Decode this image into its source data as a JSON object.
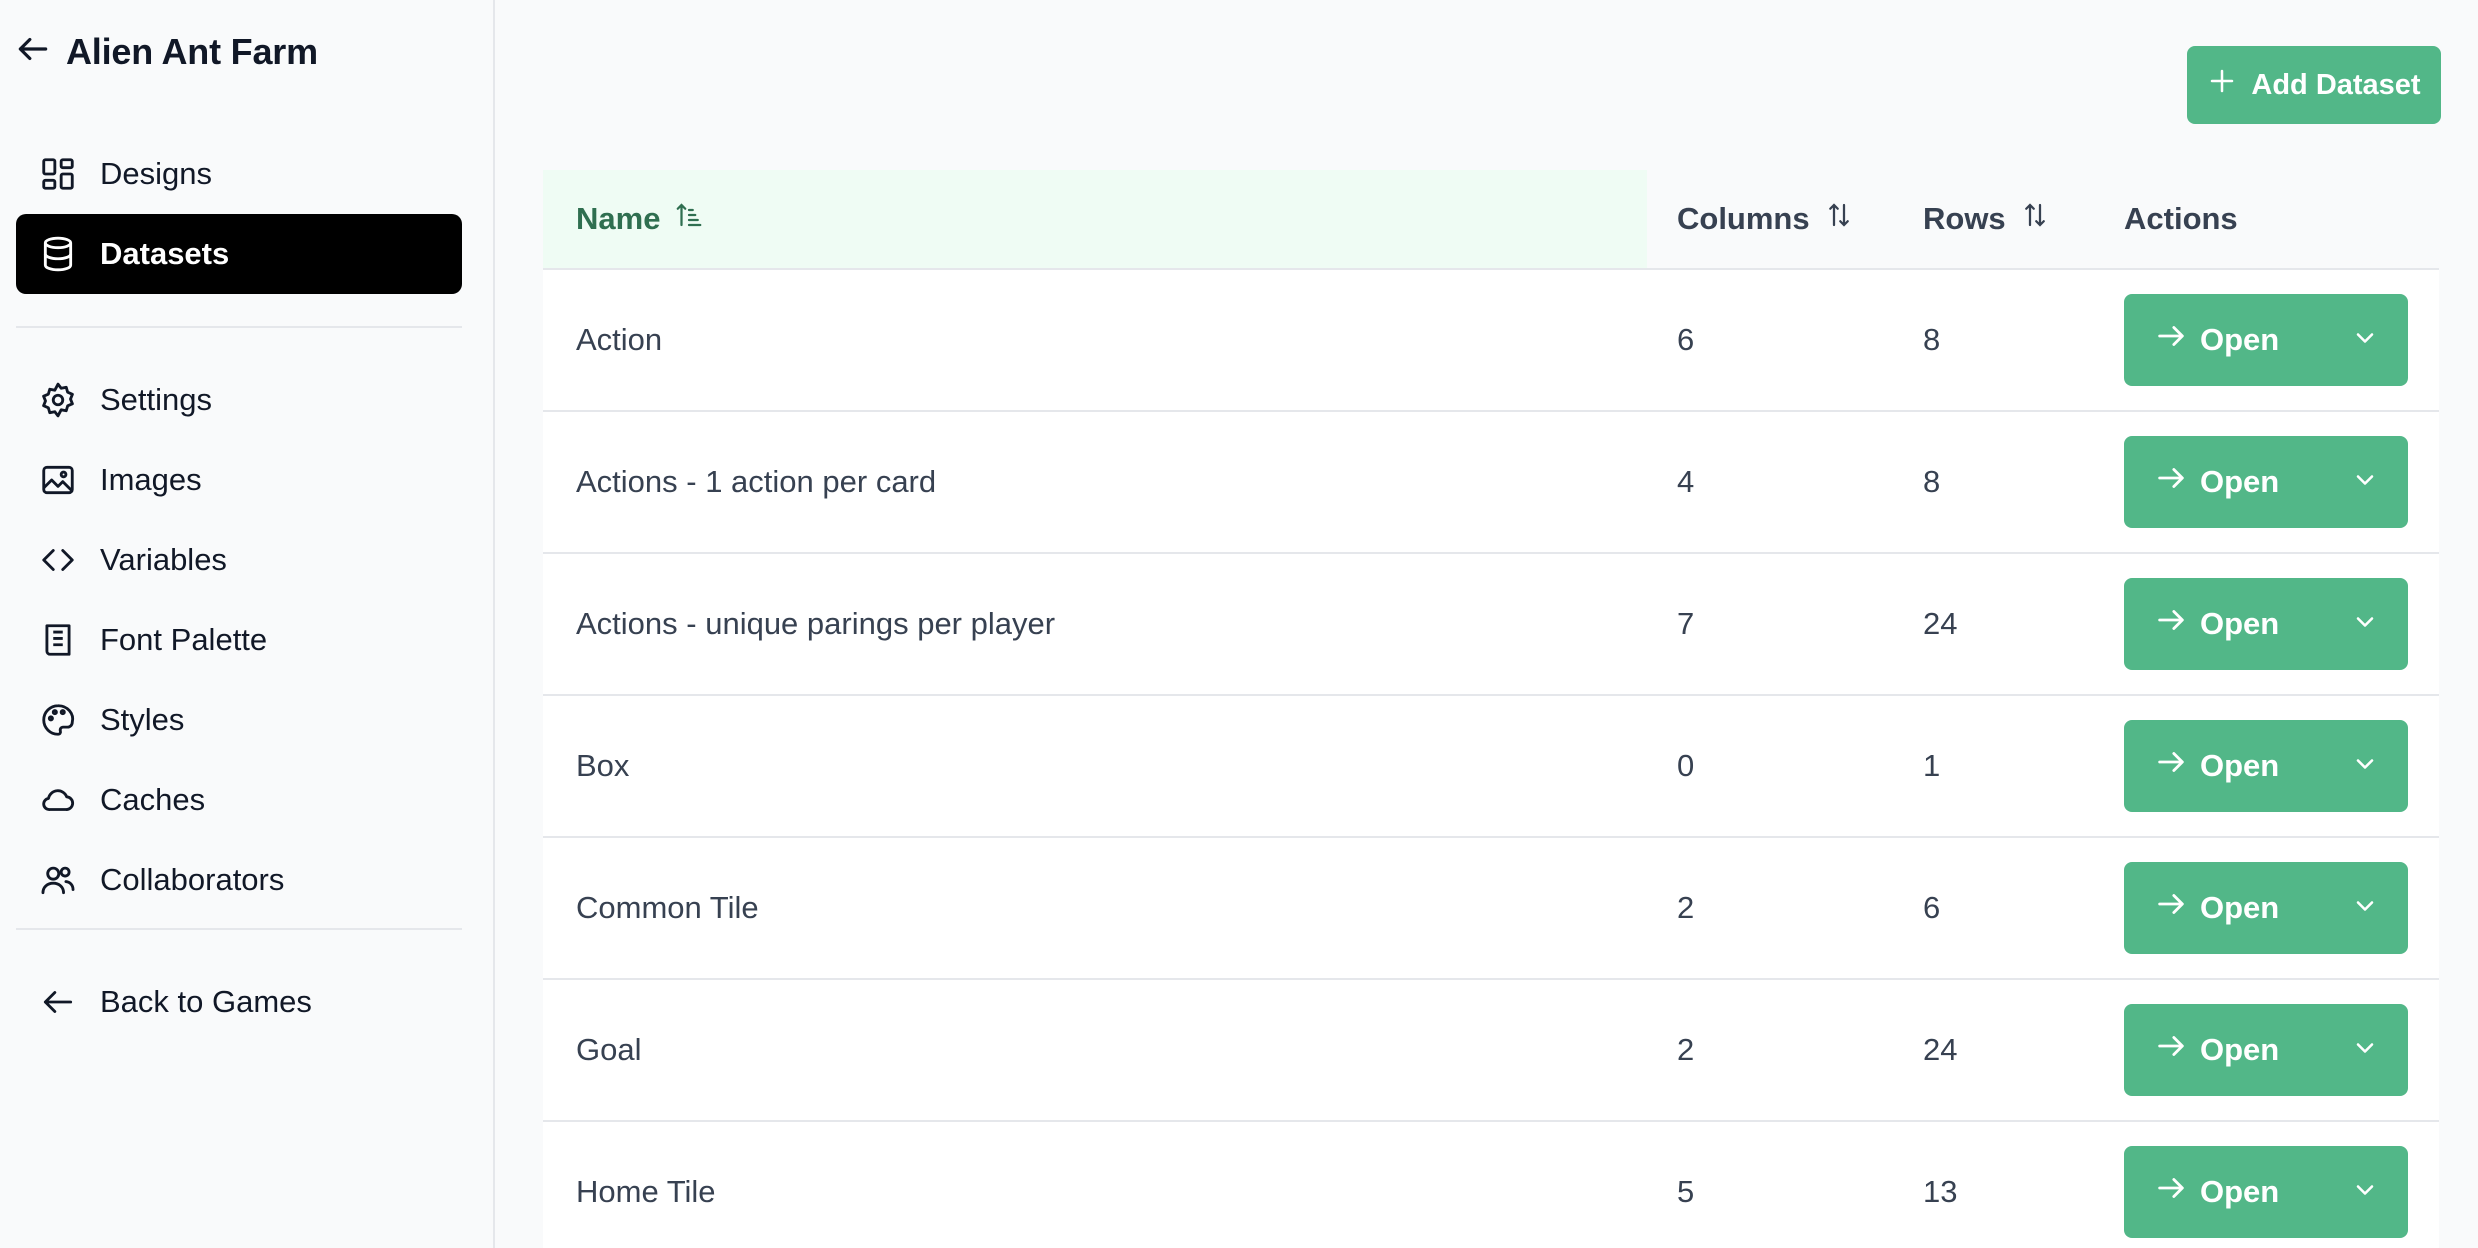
{
  "app": {
    "title": "Alien Ant Farm"
  },
  "sidebar": {
    "top_items": [
      {
        "label": "Designs",
        "icon": "layout-grid-icon"
      },
      {
        "label": "Datasets",
        "icon": "database-icon",
        "active": true
      }
    ],
    "settings_items": [
      {
        "label": "Settings",
        "icon": "gear-icon"
      },
      {
        "label": "Images",
        "icon": "image-icon"
      },
      {
        "label": "Variables",
        "icon": "code-icon"
      },
      {
        "label": "Font Palette",
        "icon": "book-icon"
      },
      {
        "label": "Styles",
        "icon": "palette-icon"
      },
      {
        "label": "Caches",
        "icon": "cloud-icon"
      },
      {
        "label": "Collaborators",
        "icon": "users-icon"
      }
    ],
    "back_label": "Back to Games"
  },
  "toolbar": {
    "add_dataset_label": "Add Dataset"
  },
  "table": {
    "headers": {
      "name": "Name",
      "columns": "Columns",
      "rows": "Rows",
      "actions": "Actions"
    },
    "open_label": "Open",
    "rows": [
      {
        "name": "Action",
        "columns": "6",
        "rows": "8"
      },
      {
        "name": "Actions - 1 action per card",
        "columns": "4",
        "rows": "8"
      },
      {
        "name": "Actions - unique parings per player",
        "columns": "7",
        "rows": "24"
      },
      {
        "name": "Box",
        "columns": "0",
        "rows": "1"
      },
      {
        "name": "Common Tile",
        "columns": "2",
        "rows": "6"
      },
      {
        "name": "Goal",
        "columns": "2",
        "rows": "24"
      },
      {
        "name": "Home Tile",
        "columns": "5",
        "rows": "13"
      }
    ]
  },
  "colors": {
    "accent": "#52b788",
    "active_nav": "#000000",
    "header_highlight": "#effcf4",
    "header_text": "#2f6f50"
  }
}
